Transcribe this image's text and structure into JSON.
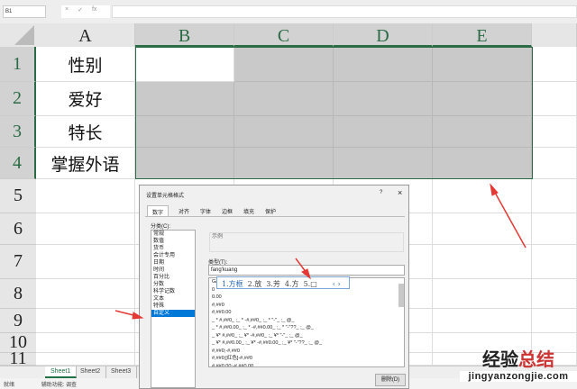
{
  "formula_bar": {
    "name_box": "B1",
    "cancel": "×",
    "enter": "✓",
    "fx": "fx"
  },
  "columns": [
    "A",
    "B",
    "C",
    "D",
    "E"
  ],
  "rows": [
    "1",
    "2",
    "3",
    "4",
    "5",
    "6",
    "7",
    "8",
    "9",
    "10",
    "11"
  ],
  "cells_a": [
    "性别",
    "爱好",
    "特长",
    "掌握外语"
  ],
  "sheets": [
    "Sheet1",
    "Sheet2",
    "Sheet3"
  ],
  "status": {
    "ready": "就绪",
    "accessibility": "辅助功能: 调查"
  },
  "dialog": {
    "title": "设置单元格格式",
    "help": "?",
    "close": "×",
    "tabs": [
      "数字",
      "对齐",
      "字体",
      "边框",
      "填充",
      "保护"
    ],
    "category_label": "分类(C):",
    "categories": [
      "常规",
      "数值",
      "货币",
      "会计专用",
      "日期",
      "时间",
      "百分比",
      "分数",
      "科学记数",
      "文本",
      "特殊",
      "自定义"
    ],
    "sample_label": "示例",
    "type_label": "类型(T):",
    "type_value": "fang'kuang",
    "formats": [
      "G/通用格式",
      "0",
      "0.00",
      "#,##0",
      "#,##0.00",
      "_ * #,##0_ ;_ * -#,##0_ ;_ * \"-\"_ ;_ @_",
      "_ * #,##0.00_ ;_ * -#,##0.00_ ;_ * \"-\"??_ ;_ @_",
      "_ ¥* #,##0_ ;_ ¥* -#,##0_ ;_ ¥* \"-\"_ ;_ @_",
      "_ ¥* #,##0.00_ ;_ ¥* -#,##0.00_ ;_ ¥* \"-\"??_ ;_ @_",
      "#,##0;-#,##0",
      "#,##0;[红色]-#,##0",
      "#,##0.00;-#,##0.00"
    ],
    "ime_candidates": [
      "1.方框",
      "2.放",
      "3.芳",
      "4.方",
      "5.□"
    ],
    "ime_nav": "‹ ›",
    "delete_button": "删除(D)"
  },
  "watermark": {
    "line1a": "经验",
    "line1b": "总结",
    "line2": "jingyanzongjie.com"
  },
  "colors": {
    "selection": "#2b6b45",
    "arrow": "#e53935"
  }
}
